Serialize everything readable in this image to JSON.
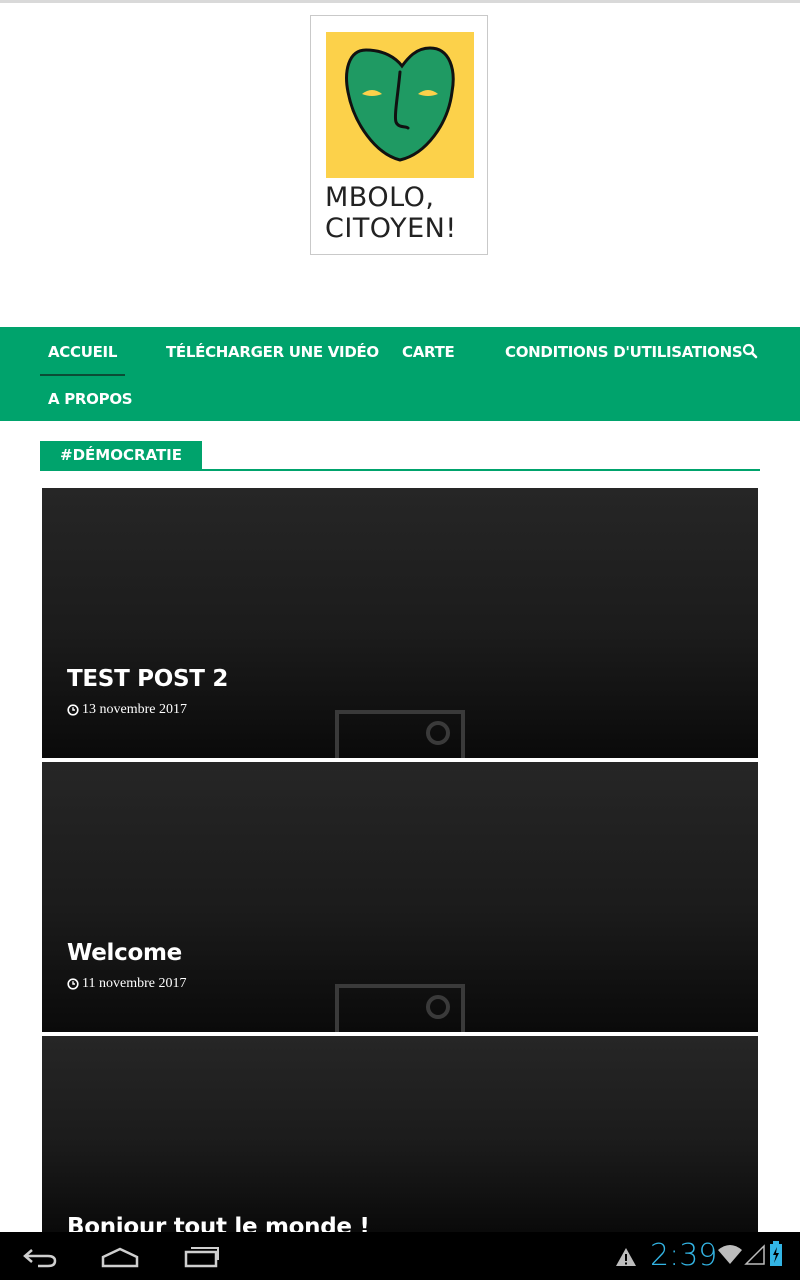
{
  "logo": {
    "line1": "MBOLO,",
    "line2": "CITOYEN!"
  },
  "nav": {
    "items": [
      {
        "label": "ACCUEIL",
        "active": true
      },
      {
        "label": "TÉLÉCHARGER UNE VIDÉO"
      },
      {
        "label": "CARTE"
      },
      {
        "label": "CONDITIONS D'UTILISATIONS"
      },
      {
        "label": "A PROPOS"
      }
    ],
    "search_icon": "search-icon"
  },
  "section": {
    "tag": "#DÉMOCRATIE"
  },
  "posts": [
    {
      "title": "TEST POST 2",
      "date": "13 novembre 2017"
    },
    {
      "title": "Welcome",
      "date": "11 novembre 2017"
    },
    {
      "title": "Bonjour tout le monde !",
      "date": ""
    }
  ],
  "status": {
    "time": "2:39"
  },
  "colors": {
    "accent": "#00a36c",
    "logo_yellow": "#fcd14a",
    "mask_green": "#1f9a63",
    "clock": "#33b5e5"
  }
}
